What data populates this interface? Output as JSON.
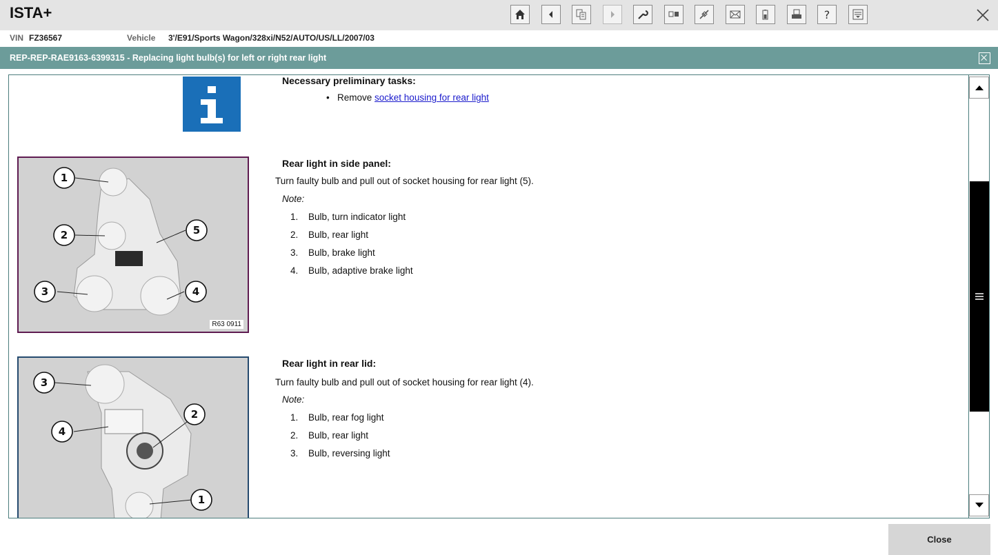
{
  "app": {
    "title": "ISTA+"
  },
  "toolbar": {
    "icons": [
      "home-icon",
      "back-icon",
      "document-icon",
      "forward-icon",
      "wrench-icon",
      "compare-icon",
      "connector-icon",
      "mail-icon",
      "battery-icon",
      "print-icon",
      "help-icon",
      "list-icon",
      "close-icon"
    ]
  },
  "vehicle": {
    "vin_label": "VIN",
    "vin": "FZ36567",
    "vehicle_label": "Vehicle",
    "vehicle": "3'/E91/Sports Wagon/328xi/N52/AUTO/US/LL/2007/03"
  },
  "document": {
    "title": "REP-REP-RAE9163-6399315  -  Replacing light bulb(s) for left or right rear light"
  },
  "content": {
    "prelim_heading": "Necessary preliminary tasks:",
    "prelim_bullet_prefix": "Remove",
    "prelim_link": "socket housing for rear light",
    "section1": {
      "heading": "Rear light in side panel:",
      "text": "Turn faulty bulb and pull out of socket housing for rear light (5).",
      "note_label": "Note:",
      "items": [
        {
          "num": "1.",
          "text": "Bulb, turn indicator light"
        },
        {
          "num": "2.",
          "text": "Bulb, rear light"
        },
        {
          "num": "3.",
          "text": "Bulb, brake light"
        },
        {
          "num": "4.",
          "text": "Bulb, adaptive brake light"
        }
      ],
      "figure_code": "R63 0911",
      "figure_callouts": [
        "1",
        "2",
        "3",
        "4",
        "5"
      ]
    },
    "section2": {
      "heading": "Rear light in rear lid:",
      "text": "Turn faulty bulb and pull out of socket housing for rear light (4).",
      "note_label": "Note:",
      "items": [
        {
          "num": "1.",
          "text": "Bulb, rear fog light"
        },
        {
          "num": "2.",
          "text": "Bulb, rear light"
        },
        {
          "num": "3.",
          "text": "Bulb, reversing light"
        }
      ],
      "figure_callouts": [
        "3",
        "4",
        "2",
        "1"
      ]
    }
  },
  "footer": {
    "close_label": "Close"
  },
  "colors": {
    "header_teal": "#6c9c9a",
    "info_blue": "#1a6fb8",
    "link_blue": "#1a1acc"
  }
}
